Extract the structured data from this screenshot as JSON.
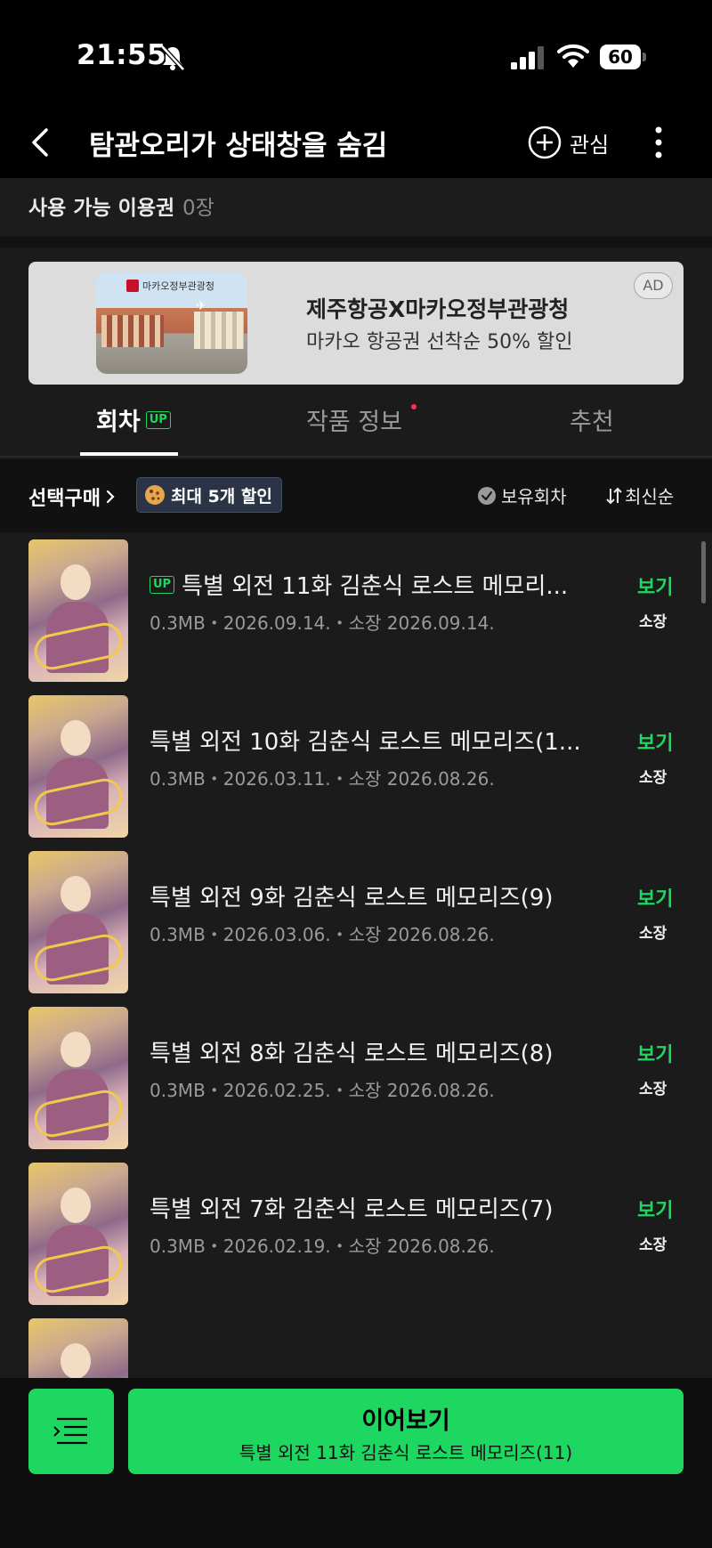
{
  "status_bar": {
    "time": "21:55",
    "battery": "60"
  },
  "header": {
    "title": "탐관오리가 상태창을 숨김",
    "favorite_label": "관심"
  },
  "voucher": {
    "label": "사용 가능 이용권",
    "count": "0장"
  },
  "ad": {
    "image_logo": "마카오정부관광청",
    "title": "제주항공X마카오정부관광청",
    "subtitle": "마카오 항공권 선착순 50% 할인",
    "badge": "AD"
  },
  "tabs": [
    {
      "label": "회차",
      "badge": "UP",
      "active": true
    },
    {
      "label": "작품 정보",
      "has_dot": true
    },
    {
      "label": "추천"
    }
  ],
  "filter": {
    "select_buy": "선택구매",
    "discount": "최대 5개 할인",
    "owned": "보유회차",
    "sort": "최신순"
  },
  "episodes": [
    {
      "up": "UP",
      "title": "특별 외전 11화 김춘식 로스트 메모리...",
      "meta": "0.3MB・2026.09.14.・소장 2026.09.14.",
      "view": "보기",
      "owned": "소장"
    },
    {
      "title": "특별 외전 10화 김춘식 로스트 메모리즈(1...",
      "meta": "0.3MB・2026.03.11.・소장 2026.08.26.",
      "view": "보기",
      "owned": "소장"
    },
    {
      "title": "특별 외전 9화 김춘식 로스트 메모리즈(9)",
      "meta": "0.3MB・2026.03.06.・소장 2026.08.26.",
      "view": "보기",
      "owned": "소장"
    },
    {
      "title": "특별 외전 8화 김춘식 로스트 메모리즈(8)",
      "meta": "0.3MB・2026.02.25.・소장 2026.08.26.",
      "view": "보기",
      "owned": "소장"
    },
    {
      "title": "특별 외전 7화 김춘식 로스트 메모리즈(7)",
      "meta": "0.3MB・2026.02.19.・소장 2026.08.26.",
      "view": "보기",
      "owned": "소장"
    }
  ],
  "bottom": {
    "continue_label": "이어보기",
    "continue_sub": "특별 외전 11화 김춘식 로스트 메모리즈(11)"
  },
  "colors": {
    "accent": "#1ed760",
    "background": "#1b1b1b",
    "dot": "#ff2d55"
  }
}
